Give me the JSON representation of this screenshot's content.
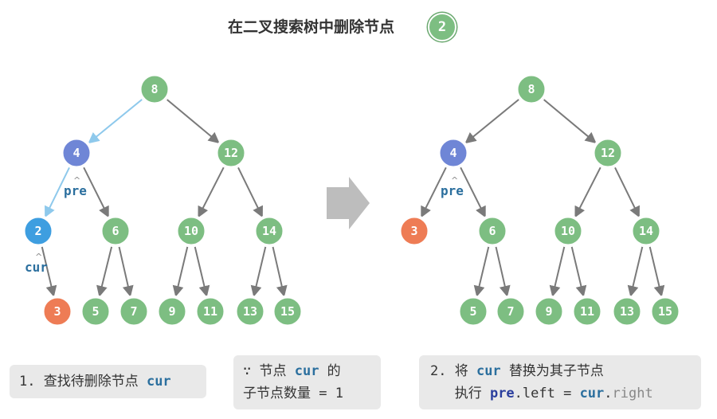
{
  "title": "在二叉搜索树中删除节点",
  "title_node": "2",
  "colors": {
    "node_default": "#7dbe82",
    "node_default_ring": "#6aa86f",
    "node_pre": "#6f86d6",
    "node_cur": "#3e9ee0",
    "node_child": "#ee7c55",
    "edge_default": "#7a7a7a",
    "edge_path": "#8ec9ec",
    "pointer_text": "#2b6f9e",
    "box_bg": "#e9e9e9"
  },
  "left_tree": {
    "nodes": [
      {
        "id": "l8",
        "label": "8",
        "role": "default"
      },
      {
        "id": "l4",
        "label": "4",
        "role": "pre"
      },
      {
        "id": "l12",
        "label": "12",
        "role": "default"
      },
      {
        "id": "l2",
        "label": "2",
        "role": "cur"
      },
      {
        "id": "l6",
        "label": "6",
        "role": "default"
      },
      {
        "id": "l10",
        "label": "10",
        "role": "default"
      },
      {
        "id": "l14",
        "label": "14",
        "role": "default"
      },
      {
        "id": "l3",
        "label": "3",
        "role": "child"
      },
      {
        "id": "l5",
        "label": "5",
        "role": "default"
      },
      {
        "id": "l7",
        "label": "7",
        "role": "default"
      },
      {
        "id": "l9",
        "label": "9",
        "role": "default"
      },
      {
        "id": "l11",
        "label": "11",
        "role": "default"
      },
      {
        "id": "l13",
        "label": "13",
        "role": "default"
      },
      {
        "id": "l15",
        "label": "15",
        "role": "default"
      }
    ],
    "edges": [
      {
        "from": "l8",
        "to": "l4",
        "highlight": true
      },
      {
        "from": "l8",
        "to": "l12",
        "highlight": false
      },
      {
        "from": "l4",
        "to": "l2",
        "highlight": true
      },
      {
        "from": "l4",
        "to": "l6",
        "highlight": false
      },
      {
        "from": "l12",
        "to": "l10",
        "highlight": false
      },
      {
        "from": "l12",
        "to": "l14",
        "highlight": false
      },
      {
        "from": "l2",
        "to": "l3",
        "highlight": false
      },
      {
        "from": "l6",
        "to": "l5",
        "highlight": false
      },
      {
        "from": "l6",
        "to": "l7",
        "highlight": false
      },
      {
        "from": "l10",
        "to": "l9",
        "highlight": false
      },
      {
        "from": "l10",
        "to": "l11",
        "highlight": false
      },
      {
        "from": "l14",
        "to": "l13",
        "highlight": false
      },
      {
        "from": "l14",
        "to": "l15",
        "highlight": false
      }
    ],
    "pointers": {
      "pre": "pre",
      "cur": "cur"
    }
  },
  "right_tree": {
    "nodes": [
      {
        "id": "r8",
        "label": "8",
        "role": "default"
      },
      {
        "id": "r4",
        "label": "4",
        "role": "pre"
      },
      {
        "id": "r12",
        "label": "12",
        "role": "default"
      },
      {
        "id": "r3",
        "label": "3",
        "role": "child"
      },
      {
        "id": "r6",
        "label": "6",
        "role": "default"
      },
      {
        "id": "r10",
        "label": "10",
        "role": "default"
      },
      {
        "id": "r14",
        "label": "14",
        "role": "default"
      },
      {
        "id": "r5",
        "label": "5",
        "role": "default"
      },
      {
        "id": "r7",
        "label": "7",
        "role": "default"
      },
      {
        "id": "r9",
        "label": "9",
        "role": "default"
      },
      {
        "id": "r11",
        "label": "11",
        "role": "default"
      },
      {
        "id": "r13",
        "label": "13",
        "role": "default"
      },
      {
        "id": "r15",
        "label": "15",
        "role": "default"
      }
    ],
    "edges": [
      {
        "from": "r8",
        "to": "r4",
        "highlight": false
      },
      {
        "from": "r8",
        "to": "r12",
        "highlight": false
      },
      {
        "from": "r4",
        "to": "r3",
        "highlight": false
      },
      {
        "from": "r4",
        "to": "r6",
        "highlight": false
      },
      {
        "from": "r12",
        "to": "r10",
        "highlight": false
      },
      {
        "from": "r12",
        "to": "r14",
        "highlight": false
      },
      {
        "from": "r6",
        "to": "r5",
        "highlight": false
      },
      {
        "from": "r6",
        "to": "r7",
        "highlight": false
      },
      {
        "from": "r10",
        "to": "r9",
        "highlight": false
      },
      {
        "from": "r10",
        "to": "r11",
        "highlight": false
      },
      {
        "from": "r14",
        "to": "r13",
        "highlight": false
      },
      {
        "from": "r14",
        "to": "r15",
        "highlight": false
      }
    ],
    "pointers": {
      "pre": "pre"
    }
  },
  "steps": {
    "step1": {
      "prefix": "1. 查找待删除节点 ",
      "ptr": "cur"
    },
    "note": {
      "line1_prefix": "∵ 节点 ",
      "line1_ptr": "cur",
      "line1_suffix": " 的",
      "line2": "子节点数量 = 1"
    },
    "step2": {
      "line1_prefix": "2. 将 ",
      "line1_ptr": "cur",
      "line1_suffix": " 替换为其子节点",
      "line2_prefix": "   执行 ",
      "line2_pre": "pre",
      "line2_dot1": ".left = ",
      "line2_cur": "cur",
      "line2_dot2": ".",
      "line2_right": "right"
    }
  }
}
